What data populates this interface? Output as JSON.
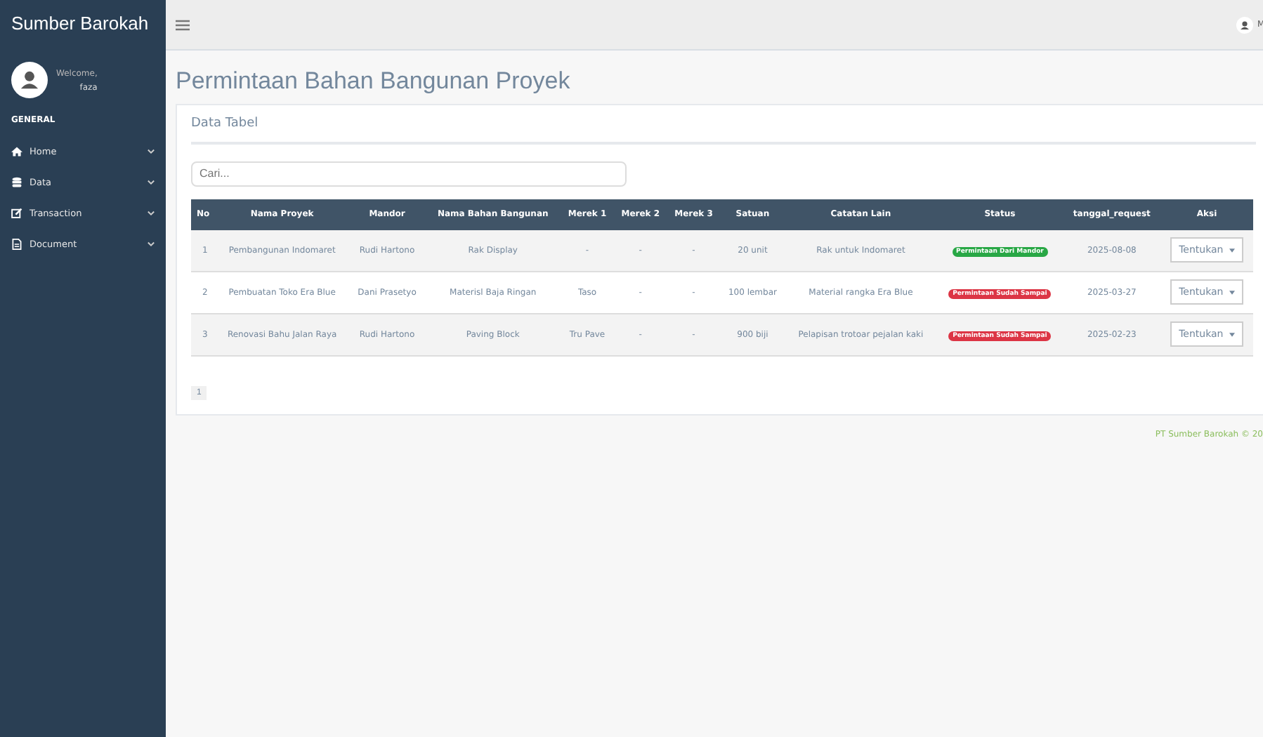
{
  "sidebar": {
    "brand": "Sumber Barokah",
    "welcome": "Welcome,",
    "user": "faza",
    "section": "GENERAL",
    "items": [
      {
        "label": "Home"
      },
      {
        "label": "Data"
      },
      {
        "label": "Transaction"
      },
      {
        "label": "Document"
      }
    ]
  },
  "topbar": {
    "user": "M"
  },
  "page_title": "Permintaan Bahan Bangunan Proyek",
  "card": {
    "title": "Data Tabel",
    "search": {
      "placeholder": "Cari..."
    },
    "table": {
      "columns": [
        "No",
        "Nama Proyek",
        "Mandor",
        "Nama Bahan Bangunan",
        "Merek 1",
        "Merek 2",
        "Merek 3",
        "Satuan",
        "Catatan Lain",
        "Status",
        "tanggal_request",
        "Aksi"
      ],
      "rows": [
        {
          "cells": [
            "1",
            "Pembangunan Indomaret",
            "Rudi Hartono",
            "Rak Display",
            "-",
            "-",
            "-",
            "20 unit",
            "Rak untuk Indomaret"
          ],
          "status": {
            "label": "Permintaan Dari Mandor",
            "color": "#28a745"
          },
          "date": "2025-08-08",
          "action": "Tentukan"
        },
        {
          "cells": [
            "2",
            "Pembuatan Toko Era Blue",
            "Dani Prasetyo",
            "Materisl Baja Ringan",
            "Taso",
            "-",
            "-",
            "100 lembar",
            "Material rangka Era Blue"
          ],
          "status": {
            "label": "Permintaan Sudah Sampai",
            "color": "#dc3545"
          },
          "date": "2025-03-27",
          "action": "Tentukan"
        },
        {
          "cells": [
            "3",
            "Renovasi Bahu Jalan Raya",
            "Rudi Hartono",
            "Paving Block",
            "Tru Pave",
            "-",
            "-",
            "900 biji",
            "Pelapisan trotoar pejalan kaki"
          ],
          "status": {
            "label": "Permintaan Sudah Sampai",
            "color": "#dc3545"
          },
          "date": "2025-02-23",
          "action": "Tentukan"
        }
      ]
    },
    "pages": [
      {
        "label": "1",
        "selected": true
      }
    ]
  },
  "footer": "PT Sumber Barokah © 20"
}
